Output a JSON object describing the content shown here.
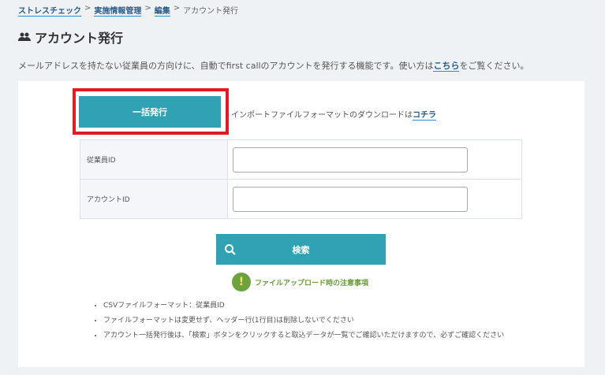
{
  "breadcrumb": {
    "items": [
      "ストレスチェック",
      "実施情報管理",
      "編集"
    ],
    "current": "アカウント発行",
    "sep": ">"
  },
  "page": {
    "title": "アカウント発行",
    "icon": "users-icon",
    "desc_before": "メールアドレスを持たない従業員の方向けに、自動でfirst callのアカウントを発行する機能です。使い方は",
    "desc_link": "こちら",
    "desc_after": "をご覧ください。"
  },
  "bulk_button": "一括発行",
  "import": {
    "text": "インポートファイルフォーマットのダウンロードは",
    "link": "コチラ"
  },
  "form": {
    "rows": [
      {
        "label": "従業員ID",
        "value": ""
      },
      {
        "label": "アカウントID",
        "value": ""
      }
    ]
  },
  "search_button": "検索",
  "notice": {
    "icon": "!",
    "text": "ファイルアップロード時の注意事項"
  },
  "notes": [
    "CSVファイルフォーマット：従業員ID",
    "ファイルフォーマットは変更せず、ヘッダー行(1行目)は削除しないでください",
    "アカウント一括発行後は、「検索」ボタンをクリックすると取込データが一覧でご確認いただけますので、必ずご確認ください"
  ],
  "colors": {
    "accent": "#31a2b3",
    "highlight": "#e01b24",
    "notice": "#6ea23e"
  }
}
